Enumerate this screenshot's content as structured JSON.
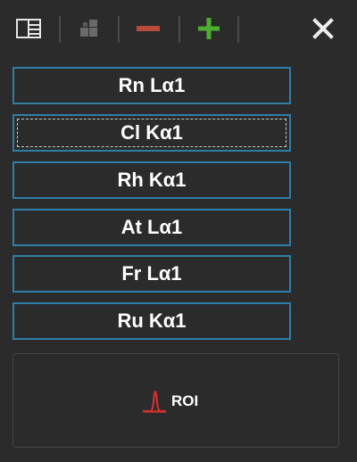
{
  "toolbar": {
    "icons": [
      "layout-icon",
      "grid-icon",
      "minus-icon",
      "plus-icon",
      "close-icon"
    ]
  },
  "lines": [
    {
      "label": "Rn Lα1"
    },
    {
      "label": "Cl Kα1"
    },
    {
      "label": "Rh Kα1"
    },
    {
      "label": "At Lα1"
    },
    {
      "label": "Fr Lα1"
    },
    {
      "label": "Ru Kα1"
    }
  ],
  "roi": {
    "label": "ROI"
  },
  "colors": {
    "background": "#2b2b2b",
    "button_border": "#2e7fa8",
    "minus": "#b84a3a",
    "plus": "#4caf2f",
    "roi_peak": "#d32f2f"
  }
}
